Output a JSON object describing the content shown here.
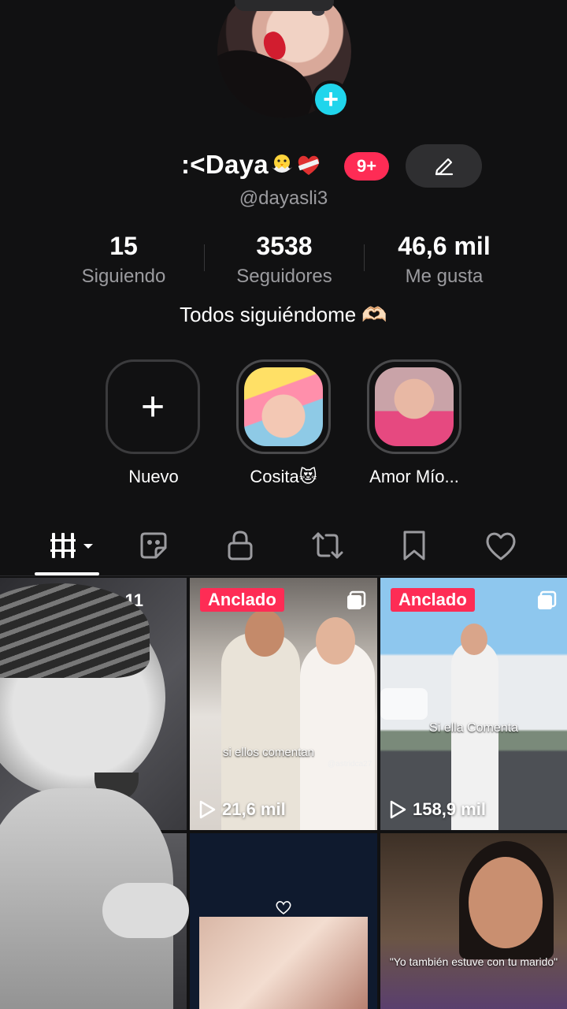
{
  "profile": {
    "display_name": ":<Daya",
    "notif_badge": "9+",
    "handle": "@dayasli3",
    "bio": "Todos siguiéndome 🫶🏻"
  },
  "stats": [
    {
      "num": "15",
      "label": "Siguiendo"
    },
    {
      "num": "3538",
      "label": "Seguidores"
    },
    {
      "num": "46,6 mil",
      "label": "Me gusta"
    }
  ],
  "highlights": [
    {
      "label": "Nuevo"
    },
    {
      "label": "Cosita😻"
    },
    {
      "label": "Amor Mío..."
    }
  ],
  "tabs": [
    "videos-grid-icon",
    "reposted-stickers-icon",
    "lock-icon",
    "repost-icon",
    "bookmark-icon",
    "heart-icon"
  ],
  "grid": {
    "cell1_overlay": "s: 11",
    "cell2": {
      "pin": "Anclado",
      "caption": "si ellos comentan",
      "watermark": "@astridca27",
      "views": "21,6 mil"
    },
    "cell3": {
      "pin": "Anclado",
      "caption": "Si ella Comenta",
      "views": "158,9 mil"
    },
    "cell6": {
      "caption": "\"Yo también estuve con tu marido\""
    }
  },
  "colors": {
    "accent": "#fe2c55",
    "add": "#20d5ec",
    "bg": "#111112"
  }
}
